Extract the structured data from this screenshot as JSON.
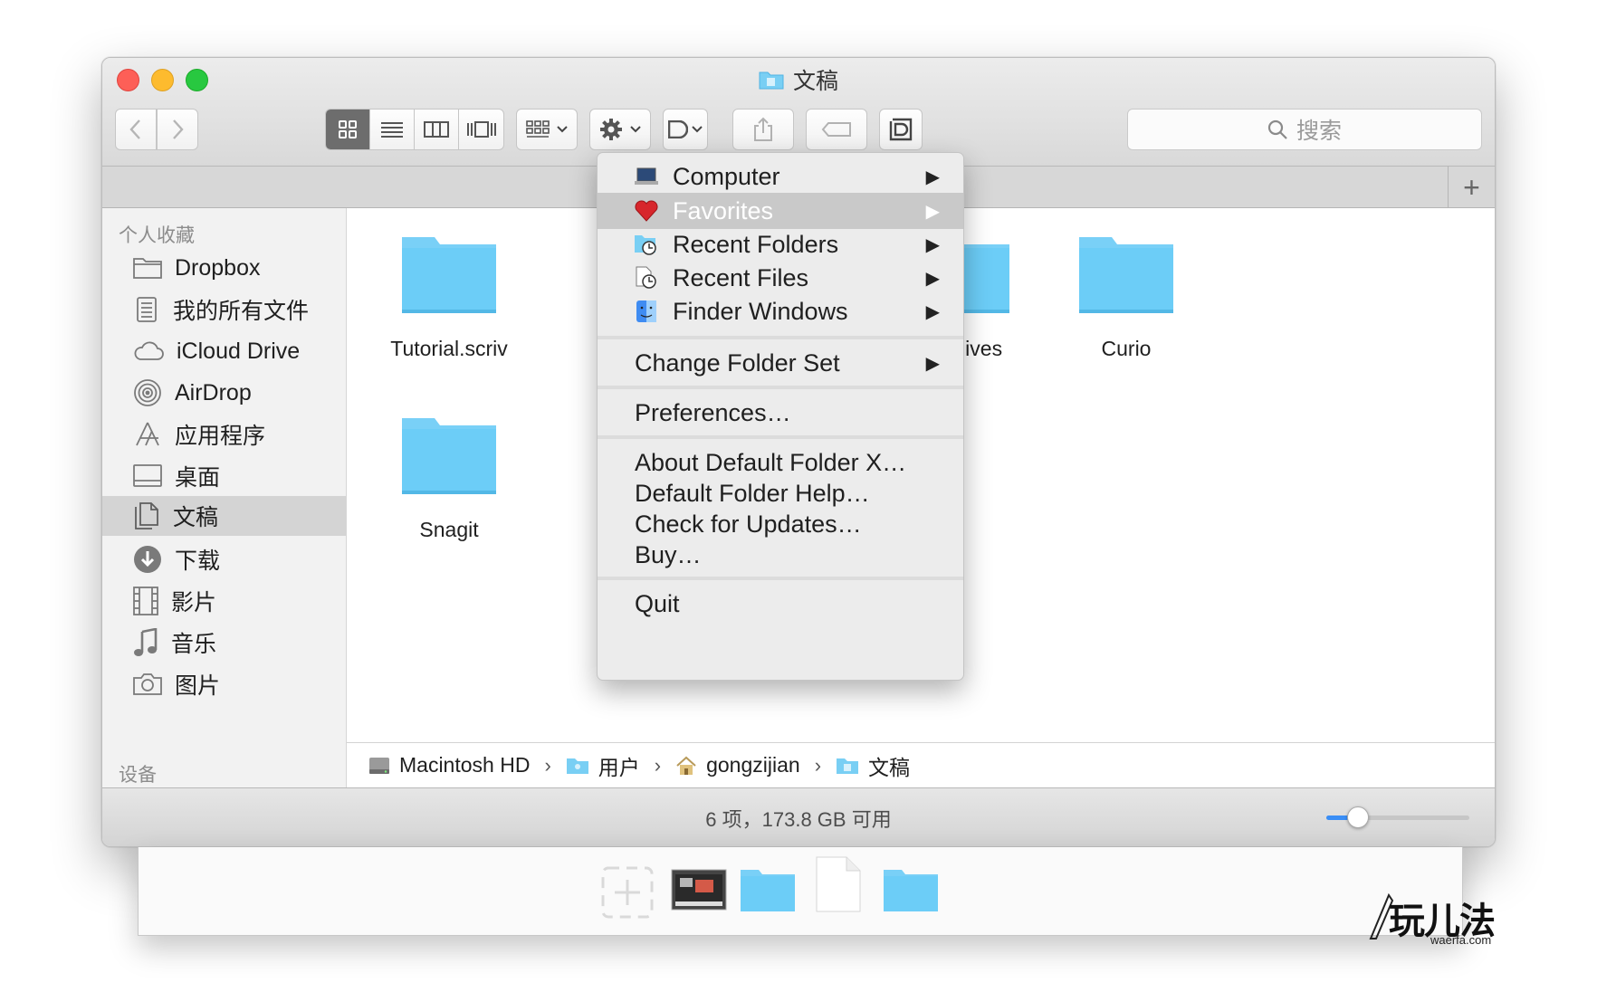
{
  "window": {
    "title": "文稿"
  },
  "toolbar": {
    "search_placeholder": "搜索",
    "add_tab_label": "+"
  },
  "sidebar": {
    "header": "个人收藏",
    "items": [
      {
        "label": "Dropbox",
        "icon": "folder-icon"
      },
      {
        "label": "我的所有文件",
        "icon": "all-files-icon"
      },
      {
        "label": "iCloud Drive",
        "icon": "cloud-icon"
      },
      {
        "label": "AirDrop",
        "icon": "airdrop-icon"
      },
      {
        "label": "应用程序",
        "icon": "applications-icon"
      },
      {
        "label": "桌面",
        "icon": "desktop-icon"
      },
      {
        "label": "文稿",
        "icon": "documents-icon",
        "selected": true
      },
      {
        "label": "下载",
        "icon": "download-icon"
      },
      {
        "label": "影片",
        "icon": "film-icon"
      },
      {
        "label": "音乐",
        "icon": "music-icon"
      },
      {
        "label": "图片",
        "icon": "camera-icon"
      }
    ],
    "devices_header": "设备"
  },
  "files": [
    {
      "name": "Tutorial.scriv"
    },
    {
      "name": "Archives"
    },
    {
      "name": "Curio"
    },
    {
      "name": "Snagit"
    }
  ],
  "menu": {
    "items": [
      {
        "label": "Computer",
        "submenu": true
      },
      {
        "label": "Favorites",
        "submenu": true,
        "highlighted": true
      },
      {
        "label": "Recent Folders",
        "submenu": true
      },
      {
        "label": "Recent Files",
        "submenu": true
      },
      {
        "label": "Finder Windows",
        "submenu": true
      },
      {
        "label": "Change Folder Set",
        "submenu": true
      },
      {
        "label": "Preferences…"
      },
      {
        "label": "About Default Folder X…"
      },
      {
        "label": "Default Folder Help…"
      },
      {
        "label": "Check for Updates…"
      },
      {
        "label": "Buy…"
      },
      {
        "label": "Quit"
      }
    ],
    "submenu_arrow": "▶"
  },
  "pathbar": {
    "segments": [
      "Macintosh HD",
      "用户",
      "gongzijian",
      "文稿"
    ],
    "separator": "›"
  },
  "statusbar": {
    "text": "6 项，173.8 GB 可用",
    "icon_size_fraction": 0.22
  },
  "watermark": {
    "big": "玩儿法",
    "small": "waerfa.com"
  },
  "colors": {
    "folder": "#6ccdf7",
    "highlight": "#c9c9c9",
    "slider_accent": "#3a8ef6"
  }
}
